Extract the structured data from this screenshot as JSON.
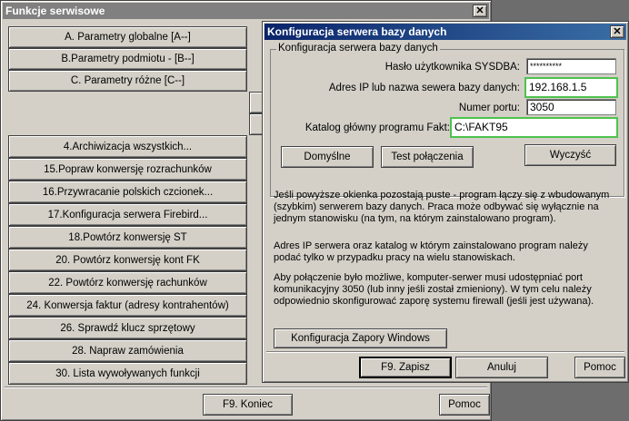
{
  "bg_window": {
    "title": "Funkcje serwisowe",
    "close": "✕",
    "buttons": [
      "A. Parametry globalne [A--]",
      "B.Parametry podmiotu - [B--]",
      "C. Parametry różne [C--]",
      "",
      "",
      "4.Archiwizacja wszystkich...",
      "15.Popraw konwersję rozrachunków",
      "16.Przywracanie polskich czcionek...",
      "17.Konfiguracja serwera Firebird...",
      "18.Powtórz konwersję ST",
      "20. Powtórz konwersję kont FK",
      "22. Powtórz konwersję rachunków",
      "24. Konwersja faktur (adresy kontrahentów)",
      "26. Sprawdź klucz sprzętowy",
      "28. Napraw zamówienia",
      "30. Lista wywoływanych funkcji"
    ],
    "end_button": "F9. Koniec",
    "help_button": "Pomoc"
  },
  "dialog": {
    "title": "Konfiguracja serwera bazy danych",
    "close": "✕",
    "group_label": "Konfiguracja serwera bazy danych",
    "password_label": "Hasło użytkownika SYSDBA:",
    "password_value": "**********",
    "ip_label": "Adres IP lub nazwa sewera bazy danych:",
    "ip_value": "192.168.1.5",
    "port_label": "Numer portu:",
    "port_value": "3050",
    "catalog_label": "Katalog główny programu Fakt:",
    "catalog_value": "C:\\FAKT95",
    "btn_defaults": "Domyślne",
    "btn_test": "Test połączenia",
    "btn_clear": "Wyczyść",
    "info_1": "Jeśli powyższe okienka pozostają puste - program łączy się z wbudowanym (szybkim) serwerem bazy danych. Praca może odbywać się wyłącznie na jednym stanowisku (na tym, na którym zainstalowano program).",
    "info_2": "Adres IP serwera oraz katalog w którym zainstalowano program należy podać tylko w przypadku pracy na wielu stanowiskach.",
    "info_3": "Aby połączenie było możliwe, komputer-serwer musi udostępniać port komunikacyjny 3050 (lub inny jeśli został zmieniony). W tym celu należy odpowiednio skonfigurować zaporę systemu firewall (jeśli jest używana).",
    "btn_firewall": "Konfiguracja Zapory Windows",
    "btn_save": "F9. Zapisz",
    "btn_cancel": "Anuluj",
    "btn_help": "Pomoc"
  }
}
